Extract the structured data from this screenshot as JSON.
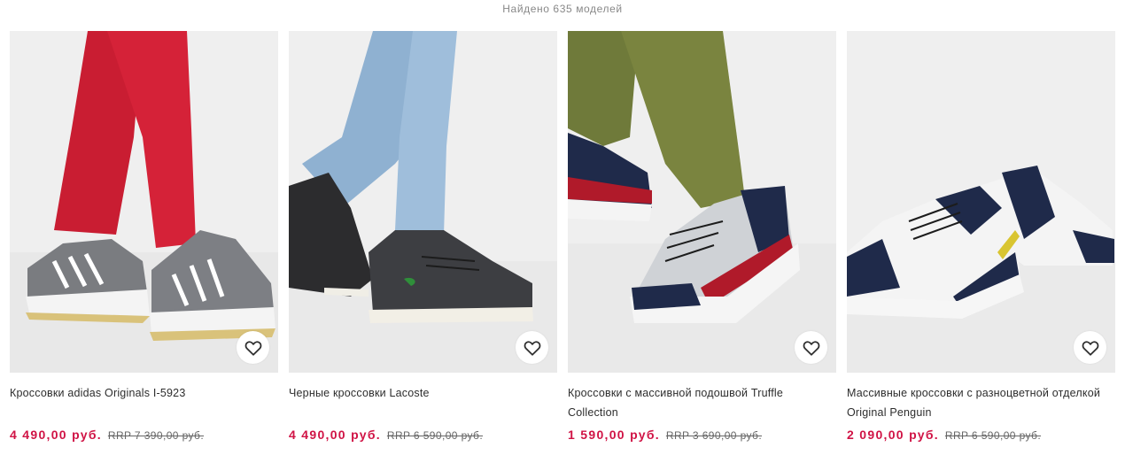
{
  "results": {
    "count_text": "Найдено 635 моделей"
  },
  "colors": {
    "price": "#d01345",
    "rrp": "#666666",
    "count": "#888888",
    "photo_bg": "#eeeeee"
  },
  "products": [
    {
      "title": "Кроссовки adidas Originals I-5923",
      "price": "4 490,00 руб.",
      "rrp": "RRP 7 390,00 руб.",
      "favorite_icon": "heart-icon"
    },
    {
      "title": "Черные кроссовки Lacoste",
      "price": "4 490,00 руб.",
      "rrp": "RRP 6 590,00 руб.",
      "favorite_icon": "heart-icon"
    },
    {
      "title": "Кроссовки с массивной подошвой Truffle Collection",
      "price": "1 590,00 руб.",
      "rrp": "RRP 3 690,00 руб.",
      "favorite_icon": "heart-icon"
    },
    {
      "title": "Массивные кроссовки с разноцветной отделкой Original Penguin",
      "price": "2 090,00 руб.",
      "rrp": "RRP 6 590,00 руб.",
      "favorite_icon": "heart-icon"
    }
  ]
}
